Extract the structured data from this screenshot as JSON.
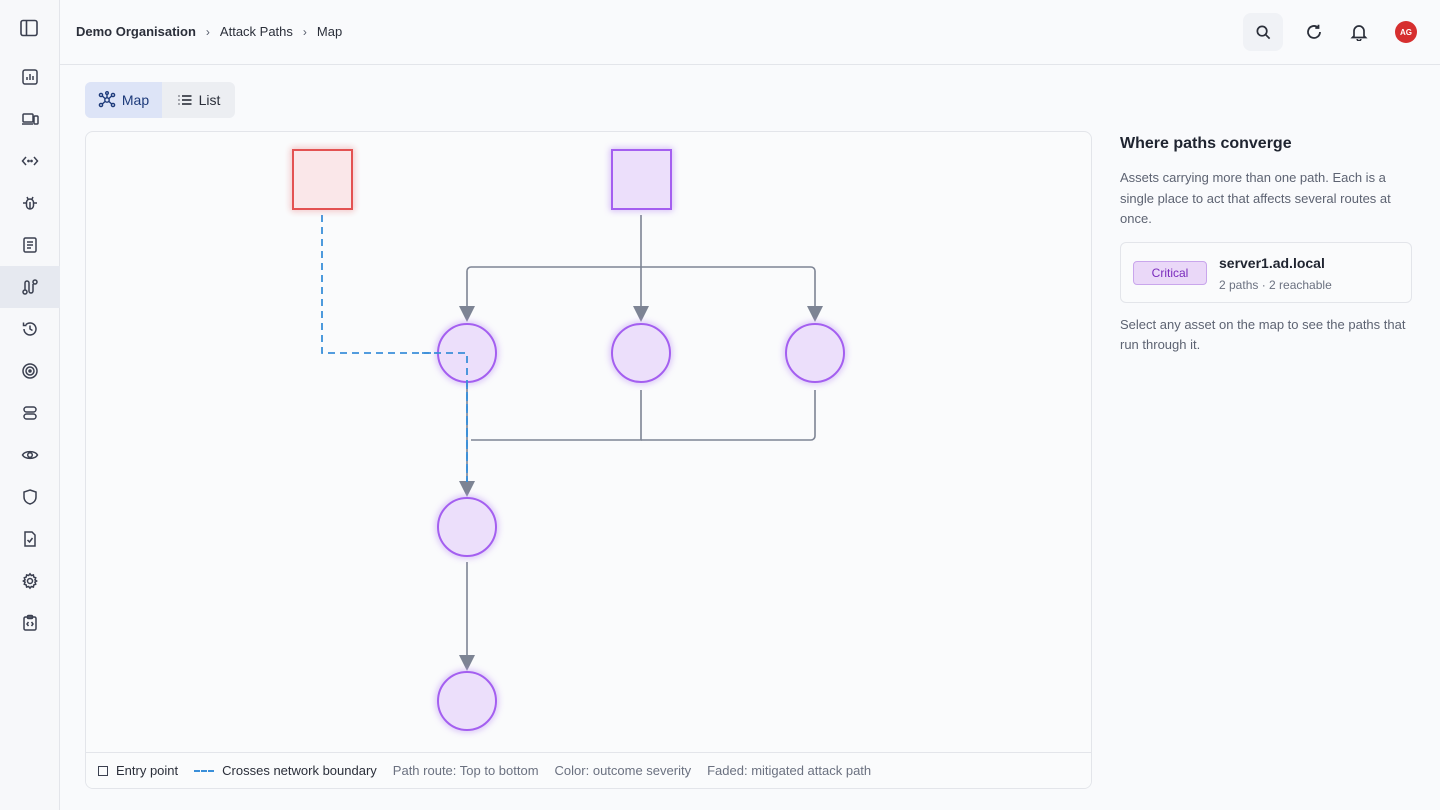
{
  "breadcrumb": {
    "org": "Demo Organisation",
    "section": "Attack Paths",
    "page": "Map"
  },
  "user": {
    "initials": "AG"
  },
  "view_toggle": {
    "map_label": "Map",
    "list_label": "List",
    "active": "Map"
  },
  "legend": {
    "entry_point": "Entry point",
    "boundary": "Crosses network boundary",
    "route": "Path route: Top to bottom",
    "color": "Color: outcome severity",
    "faded": "Faded: mitigated attack path"
  },
  "side_panel": {
    "title": "Where paths converge",
    "description": "Assets carrying more than one path. Each is a single place to act that affects several routes at once.",
    "asset": {
      "severity": "Critical",
      "name": "server1.ad.local",
      "details": "2 paths · 2 reachable"
    },
    "hint": "Select any asset on the map to see the paths that run through it."
  },
  "colors": {
    "critical": "#e24848",
    "high": "#a45ff0",
    "edge": "#7d8494",
    "boundary": "#3a8fd9"
  },
  "icons": {
    "nav": [
      "dashboard-icon",
      "devices-icon",
      "code-icon",
      "bug-icon",
      "report-icon",
      "attack-paths-icon",
      "history-icon",
      "target-icon",
      "database-icon",
      "eye-icon",
      "shield-icon",
      "file-check-icon",
      "gear-icon",
      "clipboard-code-icon"
    ],
    "top": [
      "search-icon",
      "refresh-icon",
      "bell-icon"
    ]
  }
}
